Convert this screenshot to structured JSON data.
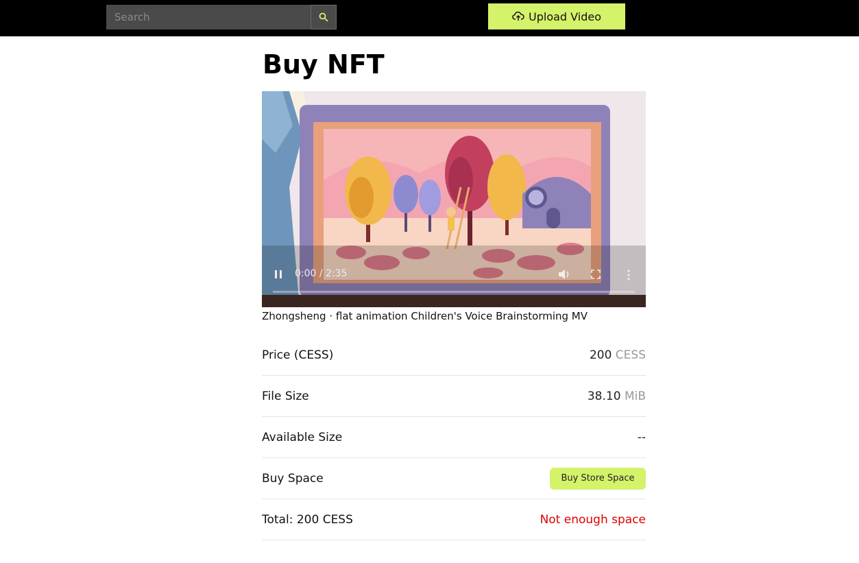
{
  "header": {
    "search_placeholder": "Search",
    "upload_label": "Upload Video",
    "accent_color": "#d4f26a"
  },
  "page": {
    "title": "Buy NFT"
  },
  "video": {
    "time": "0:00 / 2:35",
    "progress": 0,
    "caption": "Zhongsheng · flat animation Children's Voice Brainstorming MV"
  },
  "details": {
    "price_label": "Price (CESS)",
    "price_value": "200",
    "price_unit": "CESS",
    "filesize_label": "File Size",
    "filesize_value": "38.10",
    "filesize_unit": "MiB",
    "available_label": "Available Size",
    "available_value": "--",
    "buyspace_label": "Buy Space",
    "buyspace_button": "Buy Store Space",
    "total_label": "Total:",
    "total_value": "200 CESS",
    "status": "Not enough space",
    "status_color": "#e00000"
  }
}
